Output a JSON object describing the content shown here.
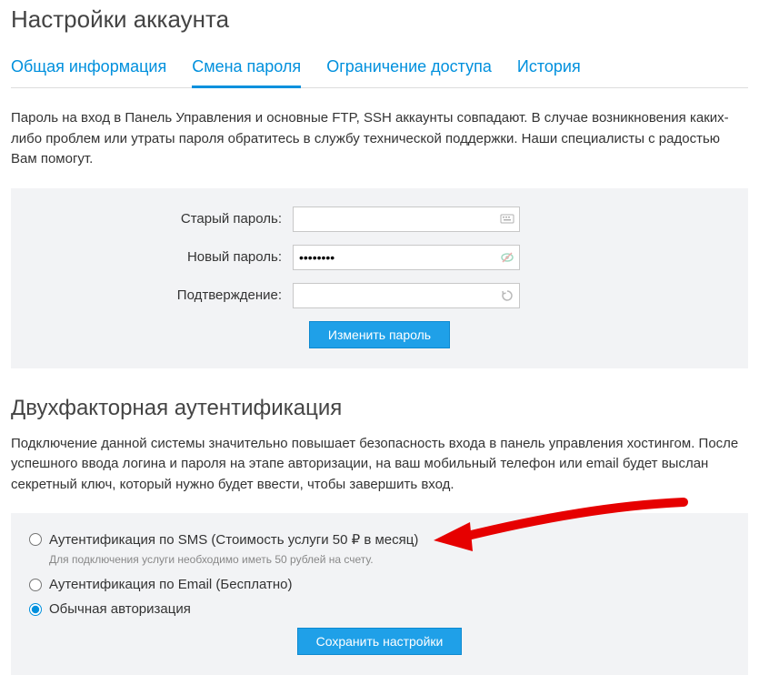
{
  "page_title": "Настройки аккаунта",
  "tabs": {
    "general": "Общая информация",
    "password": "Смена пароля",
    "access": "Ограничение доступа",
    "history": "История"
  },
  "password_section": {
    "description": "Пароль на вход в Панель Управления и основные FTP, SSH аккаунты совпадают. В случае возникновения каких-либо проблем или утраты пароля обратитесь в службу технической поддержки. Наши специалисты с радостью Вам помогут.",
    "old_label": "Старый пароль:",
    "new_label": "Новый пароль:",
    "confirm_label": "Подтверждение:",
    "new_value": "••••••••",
    "button": "Изменить пароль"
  },
  "twofa_section": {
    "title": "Двухфакторная аутентификация",
    "description": "Подключение данной системы значительно повышает безопасность входа в панель управления хостингом. После успешного ввода логина и пароля на этапе авторизации, на ваш мобильный телефон или email будет выслан секретный ключ, который нужно будет ввести, чтобы завершить вход.",
    "option_sms": "Аутентификация по SMS (Стоимость услуги 50 ₽ в месяц)",
    "sms_note": "Для подключения услуги необходимо иметь 50 рублей на счету.",
    "option_email": "Аутентификация по Email (Бесплатно)",
    "option_normal": "Обычная авторизация",
    "save_button": "Сохранить настройки"
  }
}
